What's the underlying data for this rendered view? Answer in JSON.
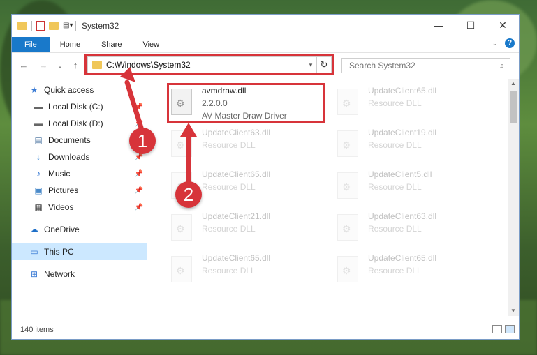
{
  "window": {
    "title": "System32"
  },
  "ribbon": {
    "tabs": [
      "File",
      "Home",
      "Share",
      "View"
    ]
  },
  "address": {
    "path": "C:\\Windows\\System32"
  },
  "search": {
    "placeholder": "Search System32"
  },
  "sidebar": {
    "items": [
      {
        "label": "Quick access",
        "icon": "star-icon",
        "pinned": false
      },
      {
        "label": "Local Disk (C:)",
        "icon": "drive-icon",
        "pinned": true
      },
      {
        "label": "Local Disk (D:)",
        "icon": "drive-icon",
        "pinned": true
      },
      {
        "label": "Documents",
        "icon": "documents-icon",
        "pinned": true
      },
      {
        "label": "Downloads",
        "icon": "download-icon",
        "pinned": true
      },
      {
        "label": "Music",
        "icon": "music-icon",
        "pinned": true
      },
      {
        "label": "Pictures",
        "icon": "pictures-icon",
        "pinned": true
      },
      {
        "label": "Videos",
        "icon": "videos-icon",
        "pinned": true
      },
      {
        "label": "OneDrive",
        "icon": "cloud-icon",
        "pinned": false
      },
      {
        "label": "This PC",
        "icon": "computer-icon",
        "pinned": false,
        "selected": true
      },
      {
        "label": "Network",
        "icon": "network-icon",
        "pinned": false
      }
    ]
  },
  "files": [
    {
      "name": "avmdraw.dll",
      "version": "2.2.0.0",
      "desc": "AV Master Draw Driver",
      "highlighted": true
    },
    {
      "name": "UpdateClient65.dll",
      "desc": "Resource DLL"
    },
    {
      "name": "UpdateClient63.dll",
      "desc": "Resource DLL"
    },
    {
      "name": "UpdateClient19.dll",
      "desc": "Resource DLL"
    },
    {
      "name": "UpdateClient65.dll",
      "desc": "Resource DLL"
    },
    {
      "name": "UpdateClient5.dll",
      "desc": "Resource DLL"
    },
    {
      "name": "UpdateClient21.dll",
      "desc": "Resource DLL"
    },
    {
      "name": "UpdateClient63.dll",
      "desc": "Resource DLL"
    },
    {
      "name": "UpdateClient65.dll",
      "desc": "Resource DLL"
    },
    {
      "name": "UpdateClient65.dll",
      "desc": "Resource DLL"
    }
  ],
  "status": {
    "item_count": "140 items"
  },
  "annotations": {
    "step1": "1",
    "step2": "2"
  },
  "colors": {
    "accent": "#1979ca",
    "highlight_red": "#d7343a",
    "selected_bg": "#cce8ff"
  }
}
